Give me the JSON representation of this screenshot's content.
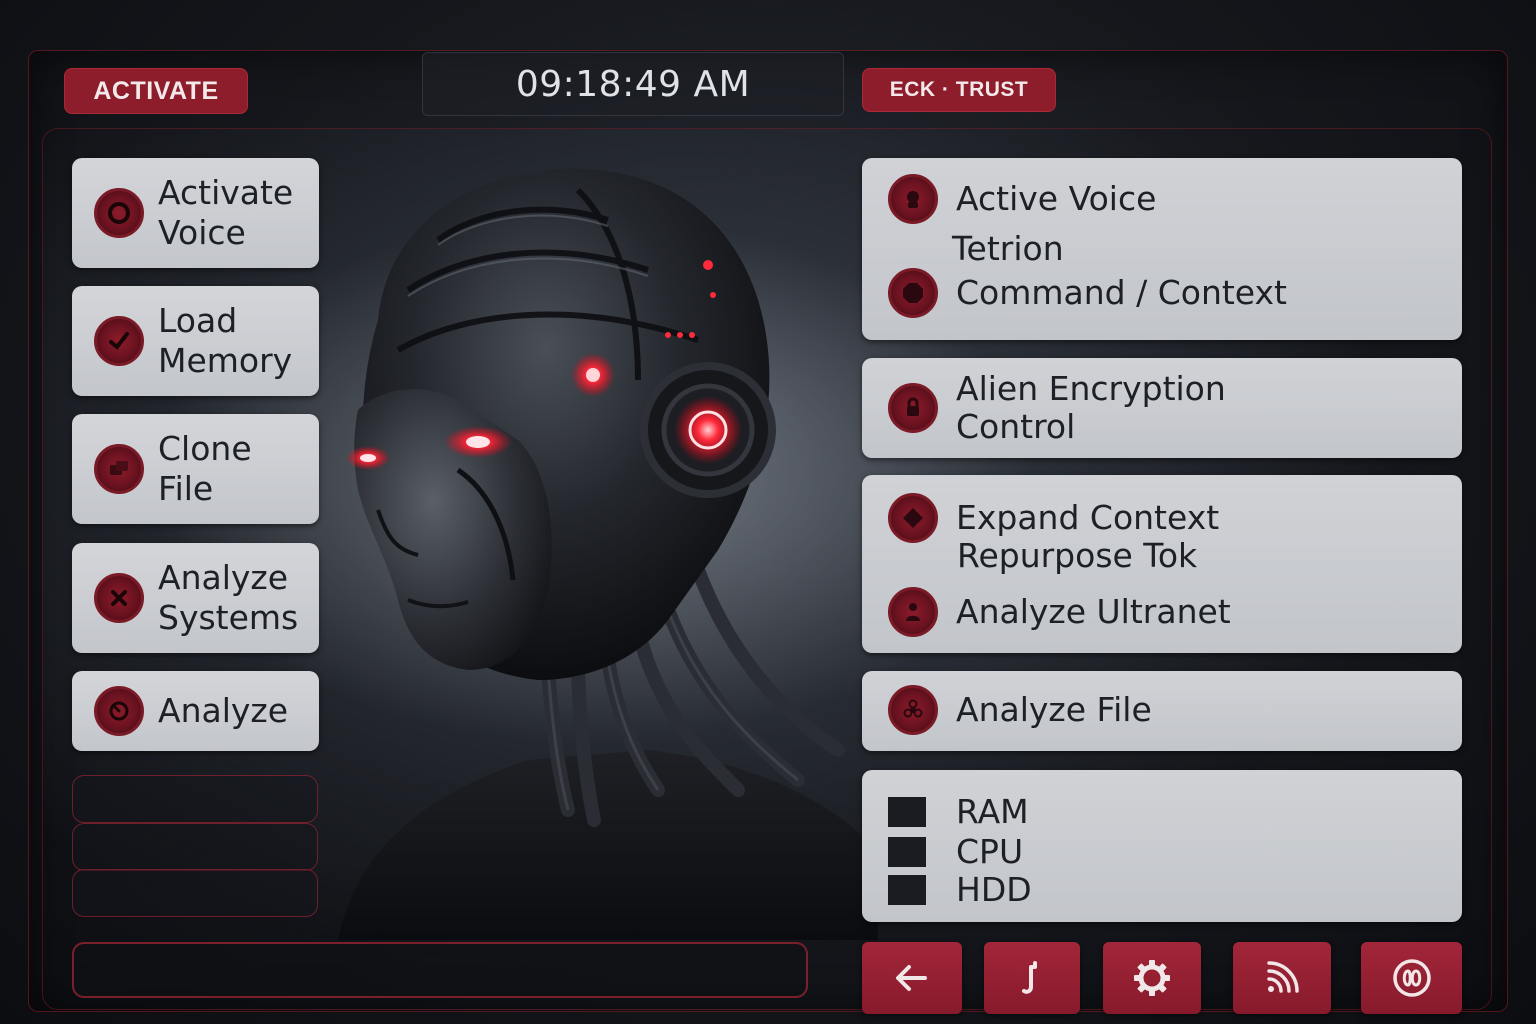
{
  "header": {
    "activate_label": "ACTIVATE",
    "clock": "09:18:49 AM",
    "trust_label": "ECK · TRUST"
  },
  "left_menu": [
    {
      "label": "Activate\nVoice",
      "icon": "ring-icon"
    },
    {
      "label": "Load\nMemory",
      "icon": "check-icon"
    },
    {
      "label": "Clone\nFile",
      "icon": "files-icon"
    },
    {
      "label": "Analyze\nSystems",
      "icon": "cross-icon"
    },
    {
      "label": "Analyze",
      "icon": "gauge-icon"
    }
  ],
  "right_panels": {
    "voice": {
      "active_voice": "Active Voice",
      "tetrion": "Tetrion",
      "command_context": "Command / Context"
    },
    "encryption": {
      "label": "Alien Encryption\nControl"
    },
    "context": {
      "expand_context": "Expand Context",
      "repurpose": "Repurpose Tok",
      "ultranet": "Analyze Ultranet"
    },
    "analyze_file": "Analyze File",
    "system": {
      "ram": "RAM",
      "cpu": "CPU",
      "hdd": "HDD"
    }
  },
  "nav_buttons": [
    {
      "icon": "back-arrow-icon"
    },
    {
      "icon": "pin-icon"
    },
    {
      "icon": "gear-icon"
    },
    {
      "icon": "signal-icon"
    },
    {
      "icon": "link-circle-icon"
    }
  ],
  "colors": {
    "accent": "#8e1d2b",
    "panel": "#c8cbd0",
    "glow_red": "#ff2a3a",
    "background": "#15171c"
  }
}
